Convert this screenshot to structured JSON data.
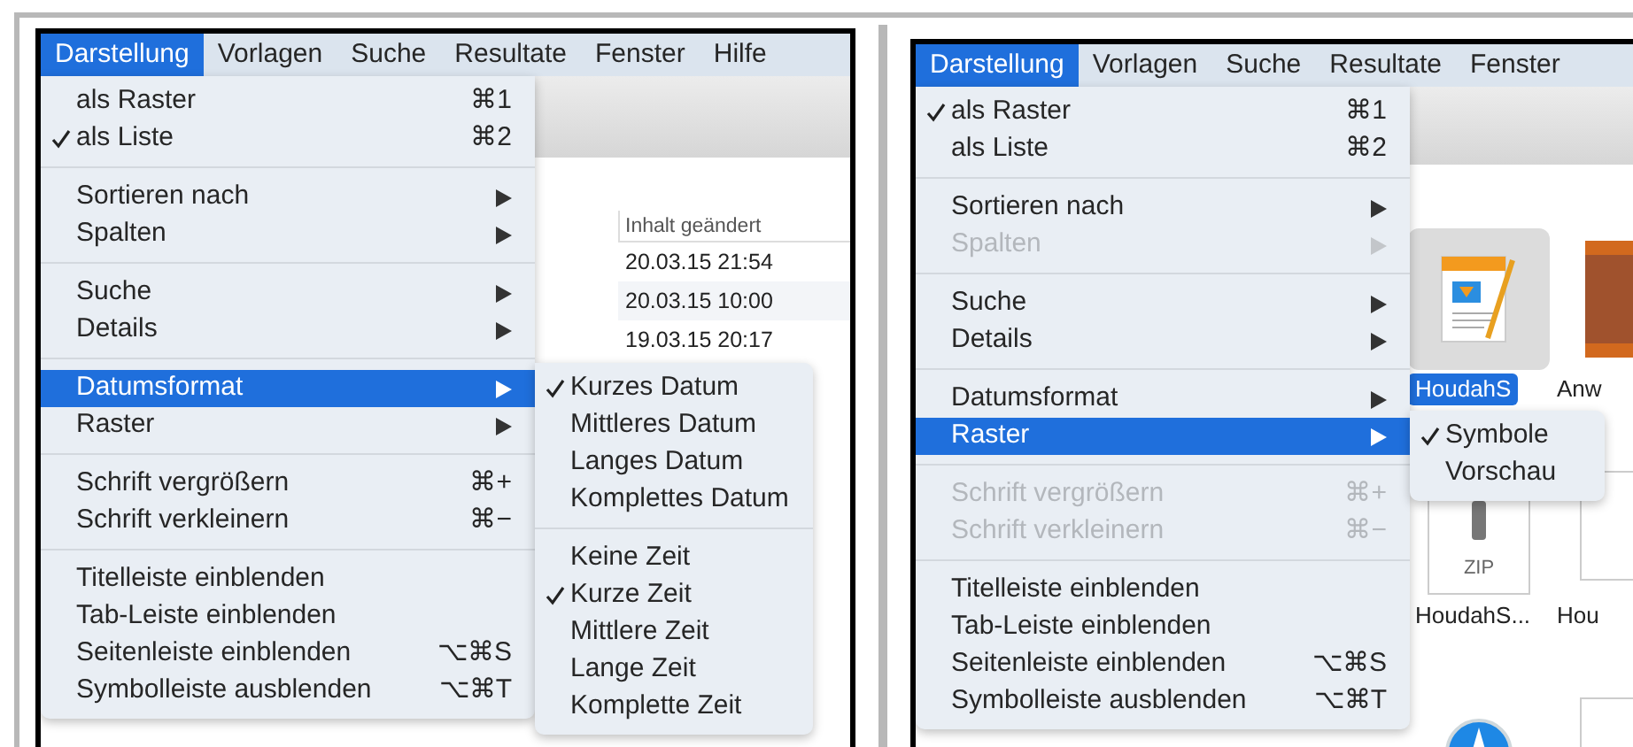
{
  "panels": [
    {
      "menubar": [
        {
          "label": "Darstellung",
          "selected": true
        },
        {
          "label": "Vorlagen",
          "selected": false
        },
        {
          "label": "Suche",
          "selected": false
        },
        {
          "label": "Resultate",
          "selected": false
        },
        {
          "label": "Fenster",
          "selected": false
        },
        {
          "label": "Hilfe",
          "selected": false
        }
      ],
      "background": {
        "kind": "list",
        "column_header": "Inhalt geändert",
        "rows": [
          "20.03.15 21:54",
          "20.03.15 10:00",
          "19.03.15 20:17"
        ]
      },
      "menu": {
        "groups": [
          {
            "items": [
              {
                "label": "als Raster",
                "shortcut": "⌘1",
                "checked": false,
                "disabled": false,
                "selected": false,
                "arrow": false
              },
              {
                "label": "als Liste",
                "shortcut": "⌘2",
                "checked": true,
                "disabled": false,
                "selected": false,
                "arrow": false
              }
            ]
          },
          {
            "items": [
              {
                "label": "Sortieren nach",
                "checked": false,
                "disabled": false,
                "selected": false,
                "arrow": true
              },
              {
                "label": "Spalten",
                "checked": false,
                "disabled": false,
                "selected": false,
                "arrow": true
              }
            ]
          },
          {
            "items": [
              {
                "label": "Suche",
                "checked": false,
                "disabled": false,
                "selected": false,
                "arrow": true
              },
              {
                "label": "Details",
                "checked": false,
                "disabled": false,
                "selected": false,
                "arrow": true
              }
            ]
          },
          {
            "items": [
              {
                "label": "Datumsformat",
                "checked": false,
                "disabled": false,
                "selected": true,
                "arrow": true,
                "submenu": {
                  "groups": [
                    {
                      "items": [
                        {
                          "label": "Kurzes Datum",
                          "checked": true
                        },
                        {
                          "label": "Mittleres Datum",
                          "checked": false
                        },
                        {
                          "label": "Langes Datum",
                          "checked": false
                        },
                        {
                          "label": "Komplettes Datum",
                          "checked": false
                        }
                      ]
                    },
                    {
                      "items": [
                        {
                          "label": "Keine Zeit",
                          "checked": false
                        },
                        {
                          "label": "Kurze Zeit",
                          "checked": true
                        },
                        {
                          "label": "Mittlere Zeit",
                          "checked": false
                        },
                        {
                          "label": "Lange Zeit",
                          "checked": false
                        },
                        {
                          "label": "Komplette Zeit",
                          "checked": false
                        }
                      ]
                    }
                  ]
                }
              },
              {
                "label": "Raster",
                "checked": false,
                "disabled": false,
                "selected": false,
                "arrow": true
              }
            ]
          },
          {
            "items": [
              {
                "label": "Schrift vergrößern",
                "shortcut": "⌘+",
                "checked": false,
                "disabled": false,
                "selected": false,
                "arrow": false
              },
              {
                "label": "Schrift verkleinern",
                "shortcut": "⌘−",
                "checked": false,
                "disabled": false,
                "selected": false,
                "arrow": false
              }
            ]
          },
          {
            "items": [
              {
                "label": "Titelleiste einblenden",
                "checked": false,
                "disabled": false,
                "selected": false,
                "arrow": false
              },
              {
                "label": "Tab-Leiste einblenden",
                "checked": false,
                "disabled": false,
                "selected": false,
                "arrow": false
              },
              {
                "label": "Seitenleiste einblenden",
                "shortcut": "⌥⌘S",
                "checked": false,
                "disabled": false,
                "selected": false,
                "arrow": false
              },
              {
                "label": "Symbolleiste ausblenden",
                "shortcut": "⌥⌘T",
                "checked": false,
                "disabled": false,
                "selected": false,
                "arrow": false
              }
            ]
          }
        ]
      }
    },
    {
      "menubar": [
        {
          "label": "Darstellung",
          "selected": true
        },
        {
          "label": "Vorlagen",
          "selected": false
        },
        {
          "label": "Suche",
          "selected": false
        },
        {
          "label": "Resultate",
          "selected": false
        },
        {
          "label": "Fenster",
          "selected": false
        }
      ],
      "background": {
        "kind": "grid",
        "rows": [
          [
            {
              "label": "HoudahS",
              "selected": true,
              "kind": "pages"
            },
            {
              "label": "Anw",
              "selected": false,
              "kind": "book"
            }
          ],
          [
            {
              "label": "HoudahS...",
              "selected": false,
              "kind": "zip",
              "icon_text": "ZIP"
            },
            {
              "label": "Hou",
              "selected": false,
              "kind": "blank"
            }
          ],
          [
            {
              "kind": "compass"
            },
            {
              "kind": "blank"
            }
          ]
        ]
      },
      "menu": {
        "groups": [
          {
            "items": [
              {
                "label": "als Raster",
                "shortcut": "⌘1",
                "checked": true,
                "disabled": false,
                "selected": false,
                "arrow": false
              },
              {
                "label": "als Liste",
                "shortcut": "⌘2",
                "checked": false,
                "disabled": false,
                "selected": false,
                "arrow": false
              }
            ]
          },
          {
            "items": [
              {
                "label": "Sortieren nach",
                "checked": false,
                "disabled": false,
                "selected": false,
                "arrow": true
              },
              {
                "label": "Spalten",
                "checked": false,
                "disabled": true,
                "selected": false,
                "arrow": true
              }
            ]
          },
          {
            "items": [
              {
                "label": "Suche",
                "checked": false,
                "disabled": false,
                "selected": false,
                "arrow": true
              },
              {
                "label": "Details",
                "checked": false,
                "disabled": false,
                "selected": false,
                "arrow": true
              }
            ]
          },
          {
            "items": [
              {
                "label": "Datumsformat",
                "checked": false,
                "disabled": false,
                "selected": false,
                "arrow": true
              },
              {
                "label": "Raster",
                "checked": false,
                "disabled": false,
                "selected": true,
                "arrow": true,
                "submenu": {
                  "groups": [
                    {
                      "items": [
                        {
                          "label": "Symbole",
                          "checked": true
                        },
                        {
                          "label": "Vorschau",
                          "checked": false
                        }
                      ]
                    }
                  ]
                }
              }
            ]
          },
          {
            "items": [
              {
                "label": "Schrift vergrößern",
                "shortcut": "⌘+",
                "checked": false,
                "disabled": true,
                "selected": false,
                "arrow": false
              },
              {
                "label": "Schrift verkleinern",
                "shortcut": "⌘−",
                "checked": false,
                "disabled": true,
                "selected": false,
                "arrow": false
              }
            ]
          },
          {
            "items": [
              {
                "label": "Titelleiste einblenden",
                "checked": false,
                "disabled": false,
                "selected": false,
                "arrow": false
              },
              {
                "label": "Tab-Leiste einblenden",
                "checked": false,
                "disabled": false,
                "selected": false,
                "arrow": false
              },
              {
                "label": "Seitenleiste einblenden",
                "shortcut": "⌥⌘S",
                "checked": false,
                "disabled": false,
                "selected": false,
                "arrow": false
              },
              {
                "label": "Symbolleiste ausblenden",
                "shortcut": "⌥⌘T",
                "checked": false,
                "disabled": false,
                "selected": false,
                "arrow": false
              }
            ]
          }
        ]
      }
    }
  ]
}
